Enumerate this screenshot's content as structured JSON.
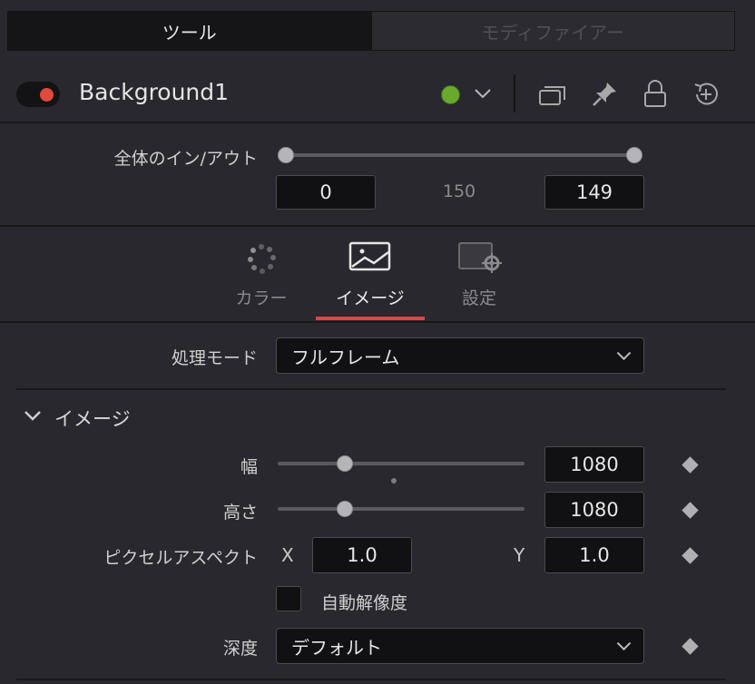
{
  "top_tabs": {
    "tools": "ツール",
    "modifiers": "モディファイアー"
  },
  "header": {
    "tool_name": "Background1"
  },
  "in_out": {
    "label": "全体のイン/アウト",
    "in_value": "0",
    "duration": "150",
    "out_value": "149"
  },
  "tabs": {
    "color": "カラー",
    "image": "イメージ",
    "settings": "設定"
  },
  "process_mode": {
    "label": "処理モード",
    "value": "フルフレーム"
  },
  "image_section": {
    "title": "イメージ",
    "width_label": "幅",
    "width_value": "1080",
    "height_label": "高さ",
    "height_value": "1080",
    "pixel_aspect_label": "ピクセルアスペクト",
    "x_label": "X",
    "x_value": "1.0",
    "y_label": "Y",
    "y_value": "1.0",
    "auto_res_label": "自動解像度",
    "depth_label": "深度",
    "depth_value": "デフォルト"
  },
  "colors": {
    "accent_red": "#e04444",
    "toggle_red": "#e0493c",
    "status_green": "#6aa92e"
  }
}
